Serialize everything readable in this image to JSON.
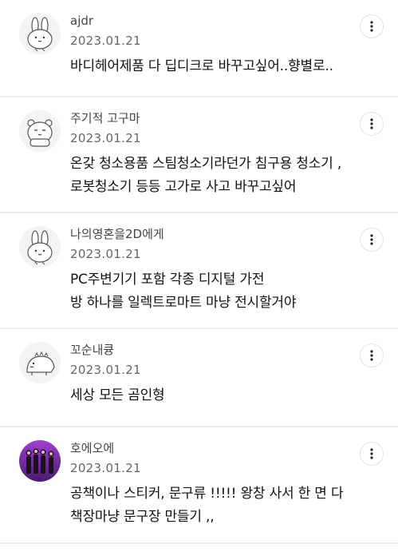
{
  "comments": [
    {
      "username": "ajdr",
      "date": "2023.01.21",
      "text": "바디헤어제품 다 딥디크로 바꾸고싶어..향별로..",
      "avatar": "bunny-avatar-icon"
    },
    {
      "username": "주기적 고구마",
      "date": "2023.01.21",
      "text": "온갖 청소용품 스팀청소기라던가 침구용 청소기 ,\n로봇청소기 등등 고가로 사고 바꾸고싶어",
      "avatar": "hamster-avatar-icon"
    },
    {
      "username": "나의영혼을2D에게",
      "date": "2023.01.21",
      "text": "PC주변기기 포함 각종 디지털 가전\n방 하나를 일렉트로마트 마냥 전시할거야",
      "avatar": "bunny-avatar-icon"
    },
    {
      "username": "꼬순내큥",
      "date": "2023.01.21",
      "text": "세상 모든 곰인형",
      "avatar": "dinosaur-avatar-icon"
    },
    {
      "username": "호에오에",
      "date": "2023.01.21",
      "text": "공책이나 스티커, 문구류 !!!!! 왕창 사서 한 면 다\n책장마냥 문구장 만들기 ,,",
      "avatar": "group-photo-avatar"
    }
  ],
  "colors": {
    "divider": "#ececec",
    "username": "#444444",
    "date": "#666666",
    "text": "#111111",
    "photo_bg": "#7a2fa8"
  }
}
